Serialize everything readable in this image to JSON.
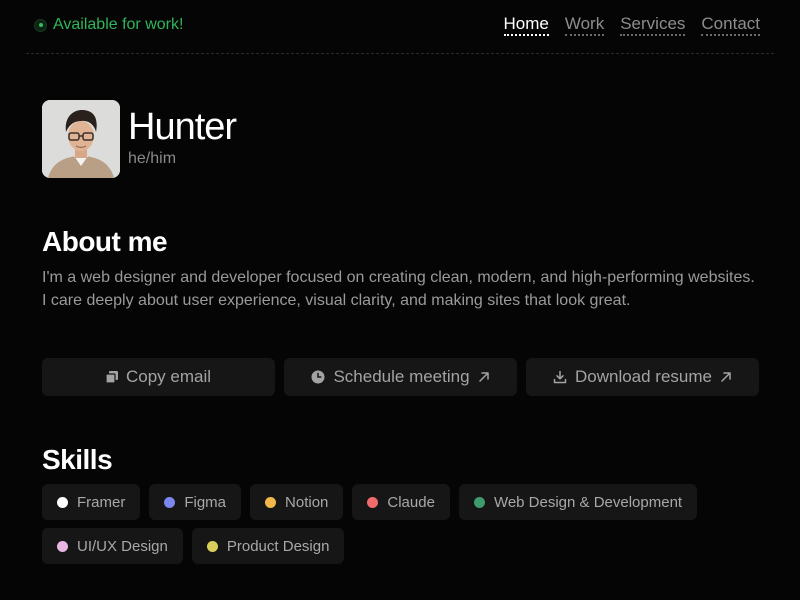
{
  "header": {
    "status_text": "Available for work!",
    "status_color": "#2fb55a",
    "nav": [
      {
        "label": "Home",
        "active": true
      },
      {
        "label": "Work",
        "active": false
      },
      {
        "label": "Services",
        "active": false
      },
      {
        "label": "Contact",
        "active": false
      }
    ]
  },
  "profile": {
    "name": "Hunter",
    "pronouns": "he/him"
  },
  "about": {
    "title": "About me",
    "text": "I'm a web designer and developer focused on creating clean, modern, and high-performing websites. I care deeply about user experience, visual clarity, and making sites that look great."
  },
  "actions": [
    {
      "label": "Copy email",
      "icon": "copy-icon",
      "external": false
    },
    {
      "label": "Schedule meeting",
      "icon": "clock-icon",
      "external": true
    },
    {
      "label": "Download resume",
      "icon": "download-icon",
      "external": true
    }
  ],
  "skills": {
    "title": "Skills",
    "items": [
      {
        "label": "Framer",
        "color": "#ffffff"
      },
      {
        "label": "Figma",
        "color": "#7b86f0"
      },
      {
        "label": "Notion",
        "color": "#f2b74a"
      },
      {
        "label": "Claude",
        "color": "#f06b6b"
      },
      {
        "label": "Web Design & Development",
        "color": "#3f9a6e"
      },
      {
        "label": "UI/UX Design",
        "color": "#e9b6e3"
      },
      {
        "label": "Product Design",
        "color": "#d8cf5a"
      }
    ]
  }
}
